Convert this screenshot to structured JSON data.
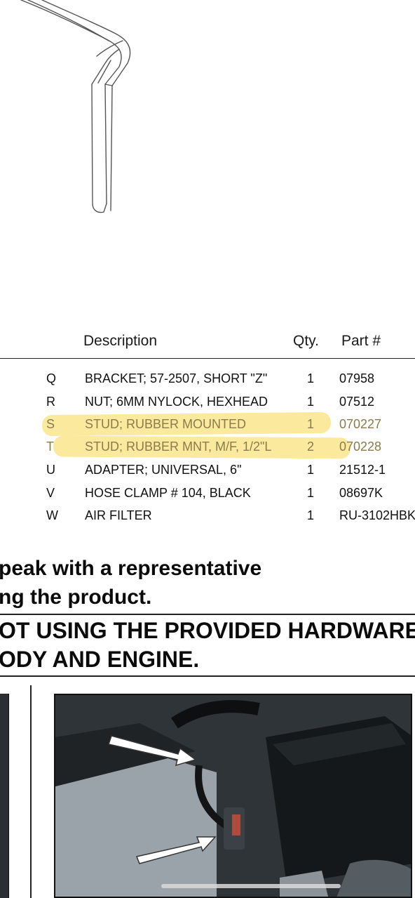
{
  "parts_table": {
    "headers": {
      "description": "Description",
      "qty": "Qty.",
      "part": "Part #"
    },
    "rows": [
      {
        "letter": "Q",
        "description": "BRACKET; 57-2507, SHORT \"Z\"",
        "qty": "1",
        "part": "07958",
        "highlighted": false
      },
      {
        "letter": "R",
        "description": "NUT; 6MM NYLOCK, HEXHEAD",
        "qty": "1",
        "part": "07512",
        "highlighted": false
      },
      {
        "letter": "S",
        "description": "STUD; RUBBER MOUNTED",
        "qty": "1",
        "part": "070227",
        "highlighted": true
      },
      {
        "letter": "T",
        "description": "STUD; RUBBER MNT, M/F, 1/2\"L",
        "qty": "2",
        "part": "070228",
        "highlighted": true
      },
      {
        "letter": "U",
        "description": "ADAPTER; UNIVERSAL, 6\"",
        "qty": "1",
        "part": "21512-1",
        "highlighted": false
      },
      {
        "letter": "V",
        "description": "HOSE CLAMP # 104, BLACK",
        "qty": "1",
        "part": "08697K",
        "highlighted": false
      },
      {
        "letter": "W",
        "description": "AIR FILTER",
        "qty": "1",
        "part": "RU-3102HBK",
        "highlighted": false
      }
    ]
  },
  "notice": {
    "line1": "peak with a representative",
    "line2": "ng the product.",
    "warning_line1": "OT USING THE PROVIDED HARDWARE",
    "warning_line2": "ODY AND ENGINE."
  },
  "colors": {
    "highlight": "#f7d94e",
    "highlight_text": "#8a7b4a",
    "rule": "#222222"
  }
}
